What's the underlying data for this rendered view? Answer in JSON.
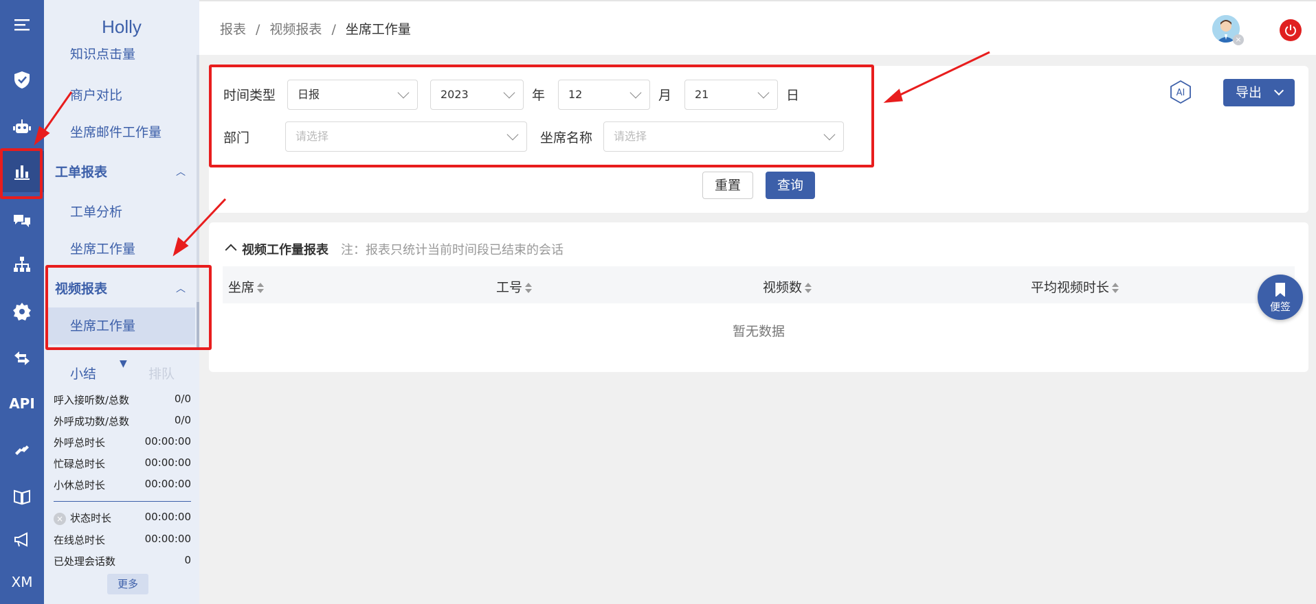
{
  "app": {
    "brand": "Holly"
  },
  "rail": {
    "items": [
      {
        "name": "menu-icon"
      },
      {
        "name": "shield-icon"
      },
      {
        "name": "robot-icon"
      },
      {
        "name": "bar-chart-icon",
        "active": true
      },
      {
        "name": "chat-icon"
      },
      {
        "name": "org-chart-icon"
      },
      {
        "name": "gear-icon"
      },
      {
        "name": "transfer-icon"
      },
      {
        "name": "api-icon",
        "text": "API"
      },
      {
        "name": "link-icon"
      },
      {
        "name": "book-icon"
      },
      {
        "name": "megaphone-icon"
      },
      {
        "name": "xm-icon",
        "text": "XM"
      }
    ]
  },
  "sidebar": {
    "partial_item": "知识点击量",
    "items": [
      {
        "label": "商户对比"
      },
      {
        "label": "坐席邮件工作量"
      }
    ],
    "group_ticket": {
      "label": "工单报表",
      "caret": "︿"
    },
    "ticket_items": [
      {
        "label": "工单分析"
      },
      {
        "label": "坐席工作量"
      }
    ],
    "group_video": {
      "label": "视频报表",
      "caret": "︿"
    },
    "video_items": [
      {
        "label": "坐席工作量",
        "active": true
      }
    ]
  },
  "summary": {
    "tab_summary": "小结",
    "tab_queue": "排队",
    "filter_icon": "▼",
    "stats": [
      {
        "label": "呼入接听数/总数",
        "value": "0/0"
      },
      {
        "label": "外呼成功数/总数",
        "value": "0/0"
      },
      {
        "label": "外呼总时长",
        "value": "00:00:00"
      },
      {
        "label": "忙碌总时长",
        "value": "00:00:00"
      },
      {
        "label": "小休总时长",
        "value": "00:00:00"
      }
    ],
    "stats2": [
      {
        "label": "状态时长",
        "value": "00:00:00"
      },
      {
        "label": "在线总时长",
        "value": "00:00:00"
      },
      {
        "label": "已处理会话数",
        "value": "0"
      }
    ],
    "more": "更多"
  },
  "header": {
    "breadcrumb": [
      "报表",
      "视频报表",
      "坐席工作量"
    ],
    "sep": "/",
    "avatar_badge": "×"
  },
  "filters": {
    "time_type_label": "时间类型",
    "time_type_value": "日报",
    "year_value": "2023",
    "year_unit": "年",
    "month_value": "12",
    "month_unit": "月",
    "day_value": "21",
    "day_unit": "日",
    "dept_label": "部门",
    "dept_placeholder": "请选择",
    "agent_label": "坐席名称",
    "agent_placeholder": "请选择",
    "ai_label": "AI",
    "export": "导出",
    "reset": "重置",
    "query": "查询"
  },
  "table": {
    "title": "视频工作量报表",
    "note": "注：报表只统计当前时间段已结束的会话",
    "columns": [
      "坐席",
      "工号",
      "视频数",
      "平均视频时长"
    ],
    "empty": "暂无数据"
  },
  "sticky_note": {
    "label": "便签"
  },
  "colors": {
    "primary": "#3c5fa9",
    "highlight": "#e81d1d"
  }
}
